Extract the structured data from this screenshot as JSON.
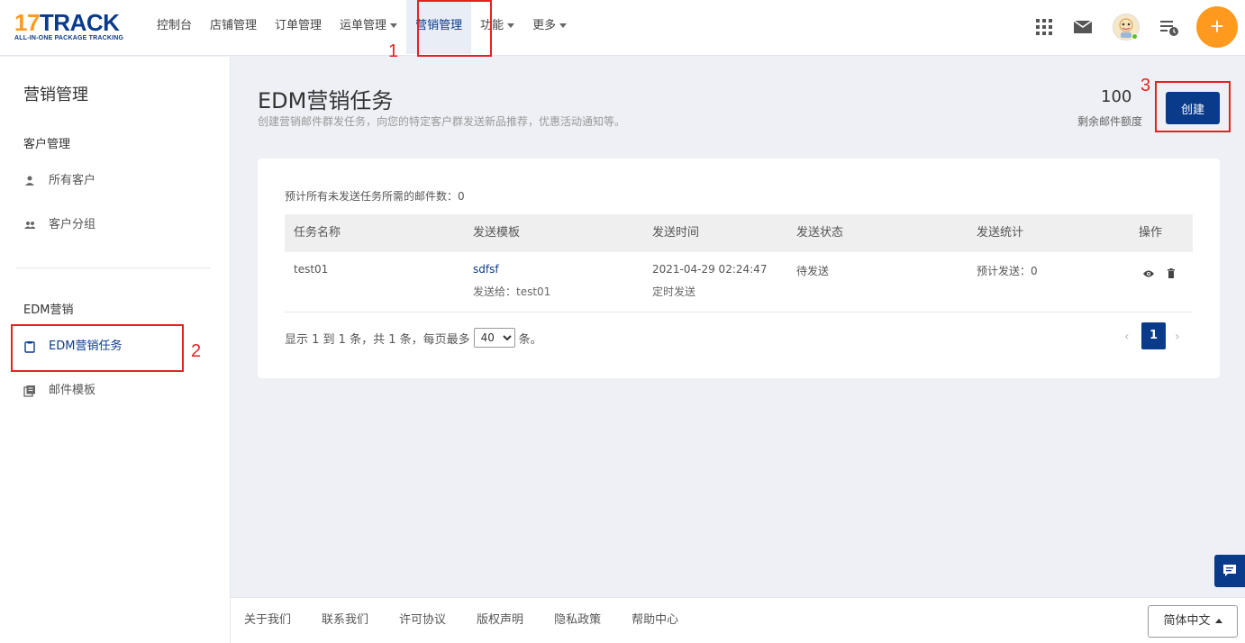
{
  "brand": {
    "logo_number": "17",
    "logo_word": "TRACK",
    "logo_tagline": "ALL-IN-ONE PACKAGE TRACKING",
    "accent": "#ff9a1f",
    "primary": "#0a3a8a"
  },
  "nav": {
    "items": [
      {
        "label": "控制台"
      },
      {
        "label": "店铺管理"
      },
      {
        "label": "订单管理"
      },
      {
        "label": "运单管理"
      },
      {
        "label": "营销管理"
      },
      {
        "label": "功能"
      },
      {
        "label": "更多"
      }
    ],
    "plus_label": "+"
  },
  "sidebar": {
    "title": "营销管理",
    "group1": "客户管理",
    "item_all_customers": "所有客户",
    "item_customer_groups": "客户分组",
    "group2": "EDM营销",
    "item_edm_tasks": "EDM营销任务",
    "item_mail_templates": "邮件模板"
  },
  "main": {
    "title": "EDM营销任务",
    "description": "创建营销邮件群发任务，向您的特定客户群发送新品推荐，优惠活动通知等。",
    "quota_value": "100",
    "quota_label": "剩余邮件额度",
    "create_label": "创建",
    "estimate_text": "预计所有未发送任务所需的邮件数：0"
  },
  "table": {
    "headers": [
      "任务名称",
      "发送模板",
      "发送时间",
      "发送状态",
      "发送统计",
      "操作"
    ],
    "rows": [
      {
        "name": "test01",
        "template": "sdfsf",
        "send_to": "发送给：test01",
        "time": "2021-04-29 02:24:47",
        "time_type": "定时发送",
        "status": "待发送",
        "stats": "预计发送：0"
      }
    ]
  },
  "pagination": {
    "info_before": "显示 1 到 1 条，共 1 条，每页最多",
    "page_size": "40",
    "info_after": "条。",
    "current_page": "1",
    "prev": "‹",
    "next": "›"
  },
  "footer": {
    "links": [
      "关于我们",
      "联系我们",
      "许可协议",
      "版权声明",
      "隐私政策",
      "帮助中心"
    ],
    "language": "简体中文"
  },
  "annotations": [
    "1",
    "2",
    "3"
  ]
}
